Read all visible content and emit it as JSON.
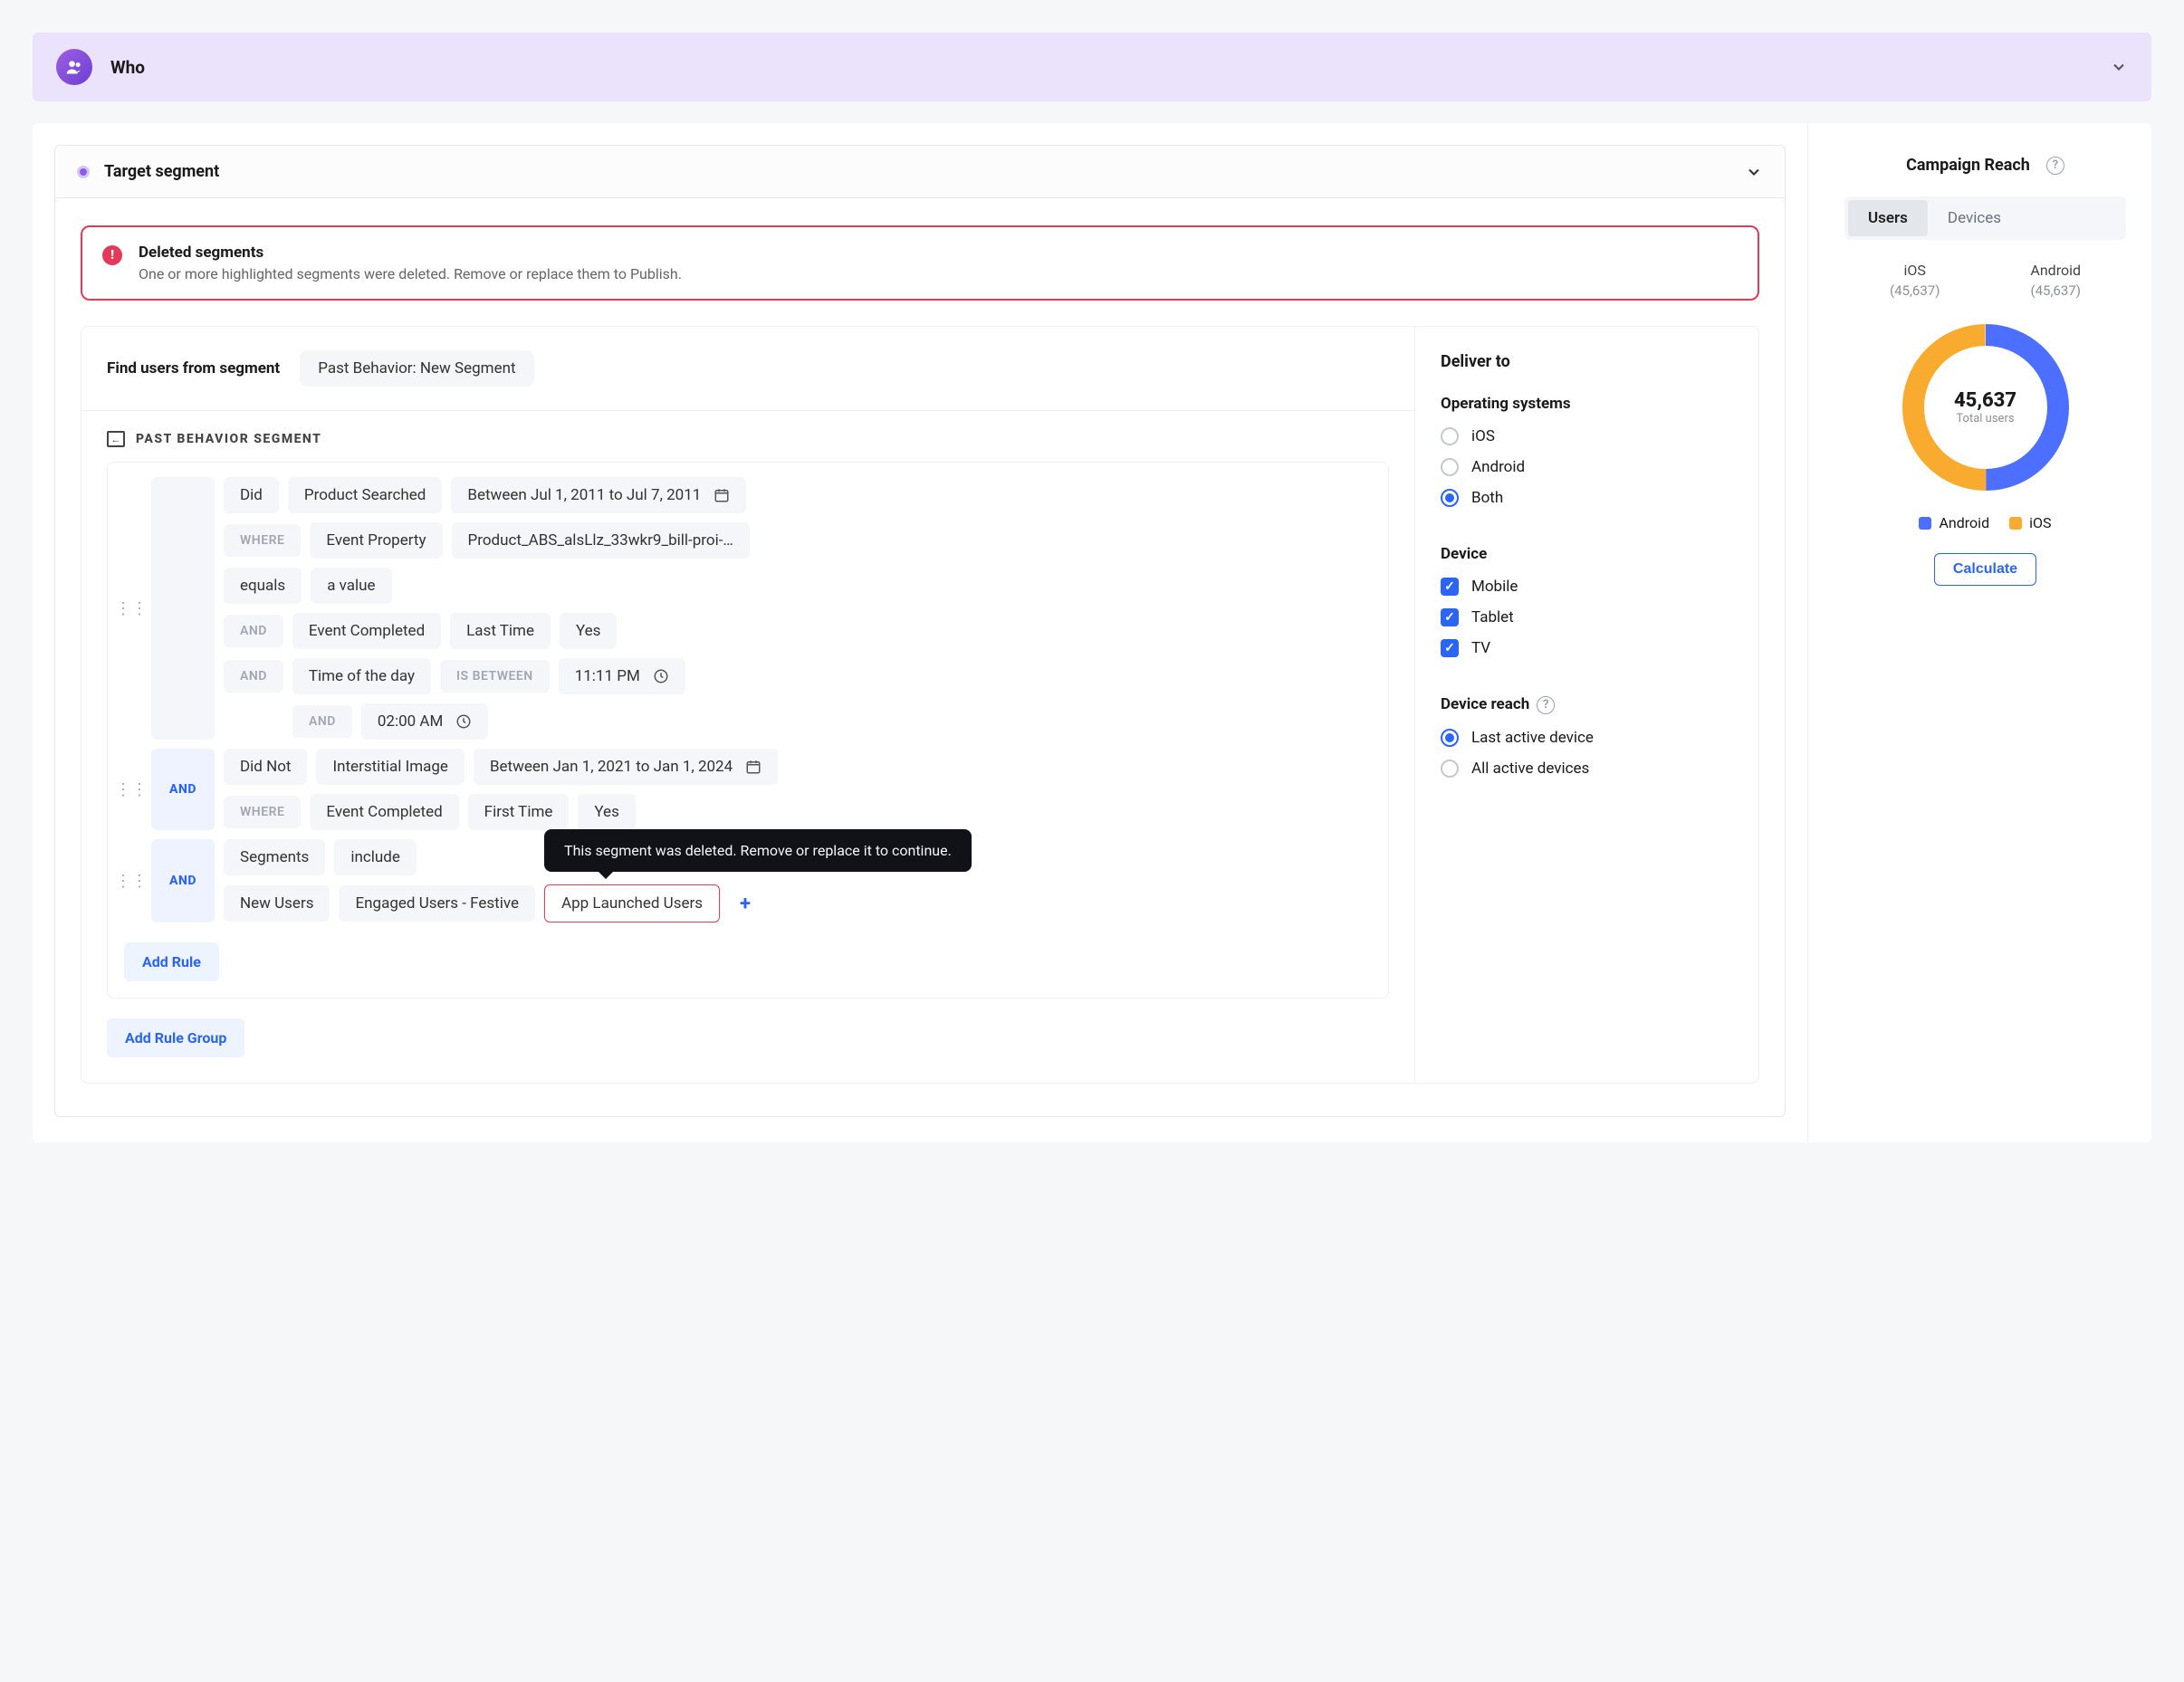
{
  "header": {
    "title": "Who"
  },
  "target_segment": {
    "title": "Target segment",
    "alert": {
      "title": "Deleted segments",
      "message": "One or more highlighted segments were deleted. Remove or replace them to Publish."
    },
    "find": {
      "label": "Find users from segment",
      "chip": "Past Behavior: New Segment"
    },
    "pbs_title": "PAST BEHAVIOR SEGMENT",
    "group1": {
      "r1_did": "Did",
      "r1_event": "Product Searched",
      "r1_date": "Between Jul 1, 2011 to Jul 7, 2011",
      "r2_where": "WHERE",
      "r2_prop": "Event Property",
      "r2_val": "Product_ABS_alsLlz_33wkr9_bill-proi-…",
      "r3_op": "equals",
      "r3_val": "a value",
      "r4_and": "AND",
      "r4_event": "Event Completed",
      "r4_a": "Last Time",
      "r4_b": "Yes",
      "r5_and": "AND",
      "r5_label": "Time of the day",
      "r5_between": "IS BETWEEN",
      "r5_time": "11:11 PM",
      "r6_and": "AND",
      "r6_time": "02:00 AM"
    },
    "group2": {
      "join": "AND",
      "r1_didnot": "Did Not",
      "r1_event": "Interstitial Image",
      "r1_date": "Between Jan 1, 2021 to Jan 1, 2024",
      "r2_where": "WHERE",
      "r2_prop": "Event Completed",
      "r2_a": "First Time",
      "r2_b": "Yes"
    },
    "group3": {
      "join": "AND",
      "r1_seg": "Segments",
      "r1_incl": "include",
      "r2_a": "New Users",
      "r2_b": "Engaged Users - Festive",
      "r2_c": "App Launched Users",
      "tooltip": "This segment was deleted. Remove or replace it to continue."
    },
    "add_rule": "Add Rule",
    "add_rule_group": "Add Rule Group"
  },
  "deliver": {
    "title": "Deliver to",
    "os_label": "Operating systems",
    "os": {
      "ios": "iOS",
      "android": "Android",
      "both": "Both",
      "selected": "both"
    },
    "device_label": "Device",
    "devices": {
      "mobile": "Mobile",
      "tablet": "Tablet",
      "tv": "TV"
    },
    "reach_label": "Device reach",
    "reach": {
      "last": "Last active device",
      "all": "All active devices",
      "selected": "last"
    }
  },
  "reach_panel": {
    "title": "Campaign Reach",
    "tabs": {
      "users": "Users",
      "devices": "Devices",
      "active": "users"
    },
    "ios_label": "iOS",
    "ios_val": "(45,637)",
    "android_label": "Android",
    "android_val": "(45,637)",
    "donut_big": "45,637",
    "donut_sub": "Total users",
    "legend_android": "Android",
    "legend_ios": "iOS",
    "calc": "Calculate",
    "colors": {
      "android": "#4c6fff",
      "ios": "#f9ab2f"
    }
  },
  "chart_data": {
    "type": "pie",
    "title": "Campaign Reach — Total users",
    "total_label": "45,637",
    "series": [
      {
        "name": "Android",
        "value": 45637,
        "color": "#4c6fff"
      },
      {
        "name": "iOS",
        "value": 45637,
        "color": "#f9ab2f"
      }
    ]
  }
}
